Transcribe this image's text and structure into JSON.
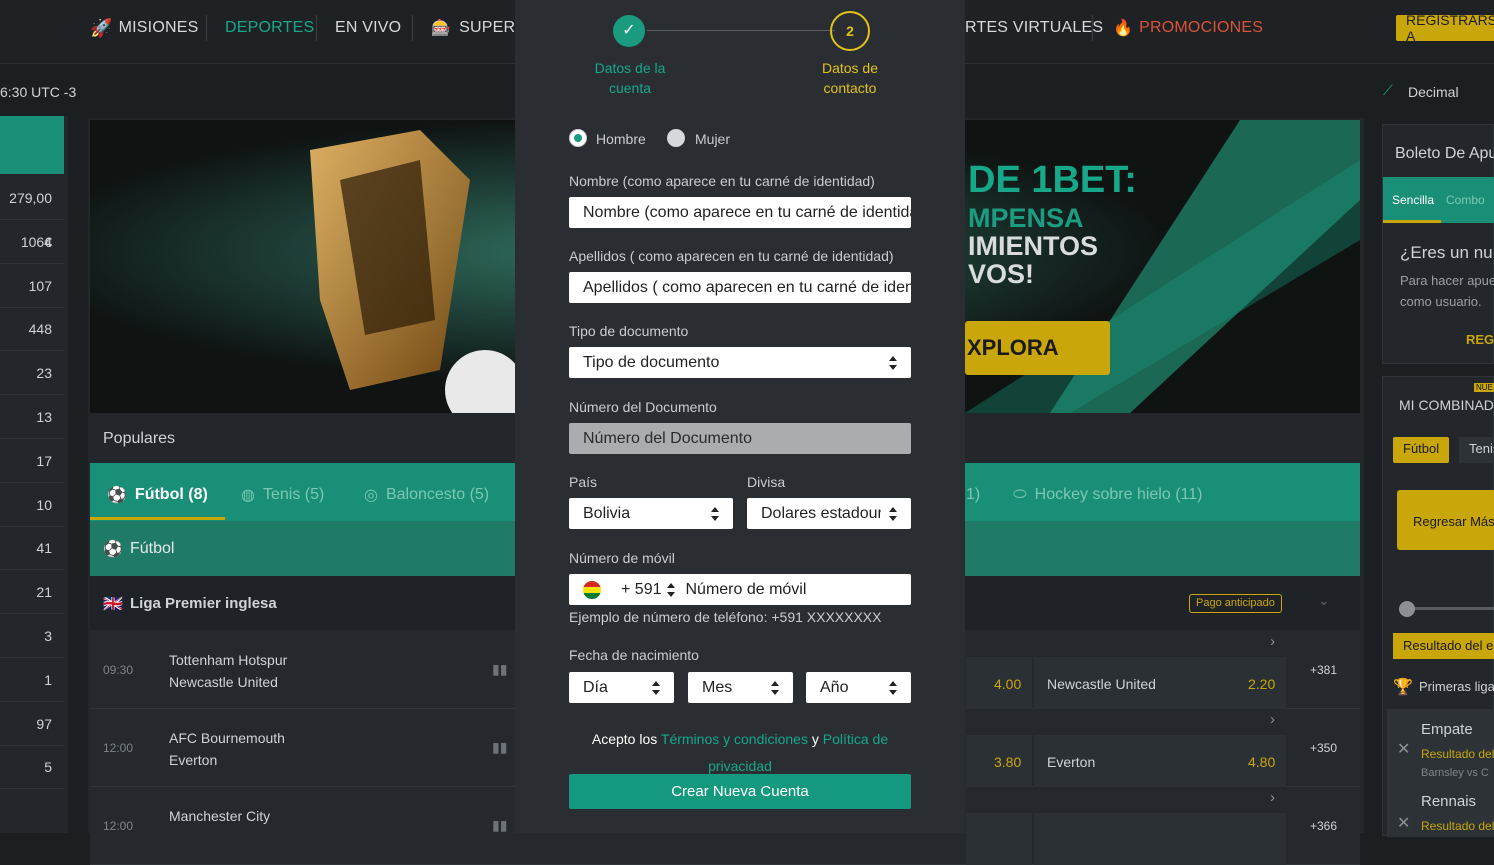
{
  "nav": {
    "items": [
      "MISIONES",
      "DEPORTES",
      "EN VIVO",
      "SUPERP",
      "RTES VIRTUALES",
      "PROMOCIONES"
    ],
    "register": "REGISTRARSE A"
  },
  "subbar": {
    "time": "6:30 UTC -3",
    "odds_format": "Decimal"
  },
  "left_col": {
    "values": [
      "279,00 €",
      "1064",
      "107",
      "448",
      "23",
      "13",
      "17",
      "10",
      "41",
      "21",
      "3",
      "1",
      "97",
      "5"
    ]
  },
  "banner": {
    "line1": "DE 1BET:",
    "line2": "MPENSA",
    "line3": "IMIENTOS",
    "line4": "VOS!",
    "cta": "XPLORA"
  },
  "populares": "Populares",
  "sport_tabs": [
    "Fútbol (8)",
    "Tenis (5)",
    "Baloncesto (5)",
    "1)",
    "Hockey sobre hielo (11)"
  ],
  "section_title": "Fútbol",
  "league": {
    "name": "Liga Premier inglesa",
    "badge": "Pago anticipado"
  },
  "matches": [
    {
      "time": "09:30",
      "home": "Tottenham Hotspur",
      "away": "Newcastle United",
      "odd_a": "4.00",
      "team_right": "Newcastle United",
      "odd_b": "2.20",
      "more": "+381"
    },
    {
      "time": "12:00",
      "home": "AFC Bournemouth",
      "away": "Everton",
      "odd_a": "3.80",
      "team_right": "Everton",
      "odd_b": "4.80",
      "more": "+350"
    },
    {
      "time": "12:00",
      "home": "Manchester City",
      "away": "",
      "odd_a": "",
      "team_right": "",
      "odd_b": "",
      "more": "+366"
    }
  ],
  "right_col": {
    "boleto": "Boleto De Apu",
    "tab_single": "Sencilla",
    "tab_combo": "Combo",
    "eres": "¿Eres un nu",
    "hacer1": "Para hacer apue",
    "hacer2": "como usuario.",
    "reg": "REGI",
    "nuevo": "NUE",
    "mi_comb": "MI COMBINADA",
    "btn_futbol": "Fútbol",
    "btn_tenis": "Tenis",
    "regresar": "Regresar Más",
    "resultado": "Resultado del e",
    "primeras": "Primeras liga",
    "empate": "Empate",
    "res_del": "Resultado del",
    "barnsley": "Barnsley vs C",
    "rennais": "Rennais",
    "res_del2": "Resultado del"
  },
  "form": {
    "step1": "Datos de la cuenta",
    "step2_num": "2",
    "step2": "Datos de contacto",
    "gender_male": "Hombre",
    "gender_female": "Mujer",
    "nombre_label": "Nombre (como aparece en tu carné de identidad)",
    "nombre_placeholder": "Nombre (como aparece en tu carné de identidad)",
    "apellidos_label": "Apellidos ( como aparecen en tu carné de identidad)",
    "apellidos_placeholder": "Apellidos ( como aparecen en tu carné de identidad)",
    "tipo_label": "Tipo de documento",
    "tipo_value": "Tipo de documento",
    "numdoc_label": "Número del Documento",
    "numdoc_placeholder": "Número del Documento",
    "pais_label": "País",
    "pais_value": "Bolivia",
    "divisa_label": "Divisa",
    "divisa_value": "Dolares estadounidenses",
    "movil_label": "Número de móvil",
    "movil_code": "+ 591",
    "movil_placeholder": "Número de móvil",
    "movil_hint": "Ejemplo de número de teléfono: +591 XXXXXXXX",
    "fecha_label": "Fecha de nacimiento",
    "dia": "Día",
    "mes": "Mes",
    "anio": "Año",
    "acepto": "Acepto los",
    "terminos": "Términos y condiciones",
    "y": "y",
    "politica1": "Política de",
    "politica2": "privacidad",
    "submit": "Crear Nueva Cuenta"
  }
}
